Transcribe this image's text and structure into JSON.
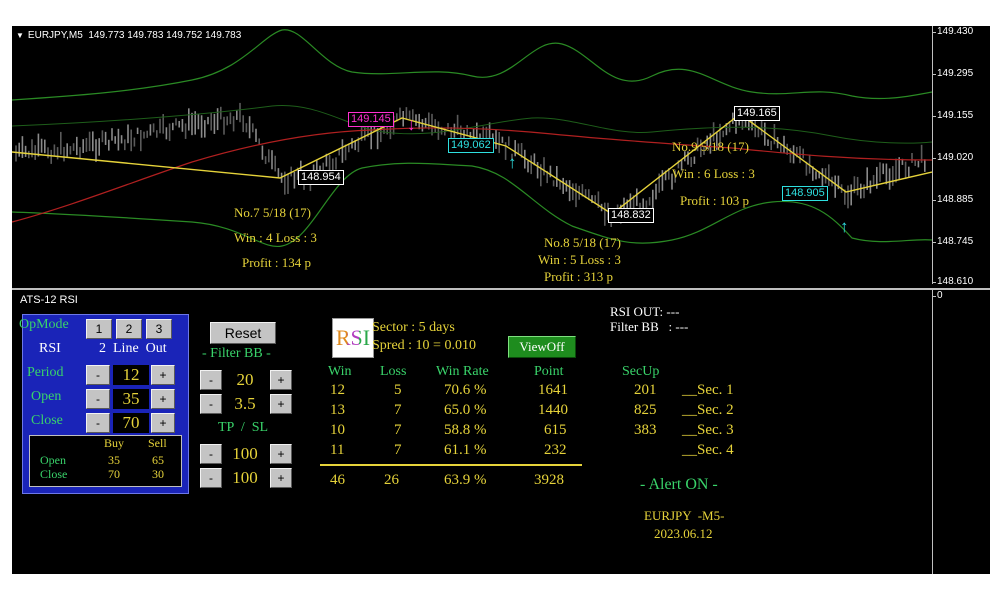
{
  "chart": {
    "symbol": "EURJPY,M5",
    "ohlc": "149.773 149.783 149.752 149.783",
    "price_axis": [
      "149.430",
      "149.295",
      "149.155",
      "149.020",
      "148.885",
      "148.745",
      "148.610"
    ],
    "trade_labels": [
      {
        "text": "148.954",
        "color": "#ffffff"
      },
      {
        "text": "149.145",
        "color": "#ff2fd0"
      },
      {
        "text": "149.062",
        "color": "#2ee0e0"
      },
      {
        "text": "148.832",
        "color": "#ffffff"
      },
      {
        "text": "149.165",
        "color": "#ffffff"
      },
      {
        "text": "148.905",
        "color": "#2ee0e0"
      }
    ],
    "trades": [
      {
        "title": "No.7   5/18 (17)",
        "win_loss": "Win : 4   Loss : 3",
        "profit": "Profit : 134 p"
      },
      {
        "title": "No.8   5/18 (17)",
        "win_loss": "Win : 5   Loss : 3",
        "profit": "Profit : 313 p"
      },
      {
        "title": "No.9   5/18 (17)",
        "win_loss": "Win : 6   Loss : 3",
        "profit": "Profit : 103 p"
      }
    ],
    "arrows": {
      "down": "↓",
      "up": "↑"
    }
  },
  "indicator": {
    "title": "ATS-12 RSI",
    "axis_zero": "0",
    "opmode": {
      "label": "OpMode",
      "buttons": [
        "1",
        "2",
        "3"
      ]
    },
    "rsi_row": {
      "label": "RSI",
      "value": "2  Line  Out"
    },
    "period": {
      "label": "Period",
      "minus": "-",
      "value": "12",
      "plus": "+"
    },
    "open": {
      "label": "Open",
      "minus": "-",
      "value": "35",
      "plus": "+"
    },
    "close": {
      "label": "Close",
      "minus": "-",
      "value": "70",
      "plus": "+"
    },
    "buysell": {
      "buy": "Buy",
      "sell": "Sell",
      "open_label": "Open",
      "open_buy": "35",
      "open_sell": "65",
      "close_label": "Close",
      "close_buy": "70",
      "close_sell": "30"
    },
    "reset_label": "Reset",
    "filter_bb": {
      "label": "- Filter BB -",
      "value1": "20",
      "value2": "3.5",
      "minus": "-",
      "plus": "+"
    },
    "tp_sl": {
      "label": "TP  /  SL",
      "value1": "100",
      "value2": "100",
      "minus": "-",
      "plus": "+"
    },
    "sector": "Sector : 5 days",
    "spread": "Spred : 10 = 0.010",
    "logo_text": "RSI",
    "viewoff_label": "ViewOff",
    "stats": {
      "headers": [
        "Win",
        "Loss",
        "Win Rate",
        "Point"
      ],
      "rows": [
        [
          "12",
          "5",
          "70.6 %",
          "1641"
        ],
        [
          "13",
          "7",
          "65.0 %",
          "1440"
        ],
        [
          "10",
          "7",
          "58.8 %",
          "615"
        ],
        [
          "11",
          "7",
          "61.1 %",
          "232"
        ]
      ],
      "total": [
        "46",
        "26",
        "63.9 %",
        "3928"
      ]
    },
    "secup": {
      "header": "SecUp",
      "values": [
        "201",
        "825",
        "383",
        ""
      ],
      "labels": [
        "__Sec. 1",
        "__Sec. 2",
        "__Sec. 3",
        "__Sec. 4"
      ]
    },
    "rsi_out": "RSI OUT: ---",
    "filter_bb_out": "Filter BB   : ---",
    "alert": "- Alert ON -",
    "symbol_tf": "EURJPY  -M5-",
    "date": "2023.06.12"
  },
  "colors": {
    "yellow": "#e6d33a",
    "green": "#39d36a",
    "cyan": "#2ee0e0",
    "magenta": "#ff2fd0",
    "panel_blue": "#1a24b8"
  }
}
